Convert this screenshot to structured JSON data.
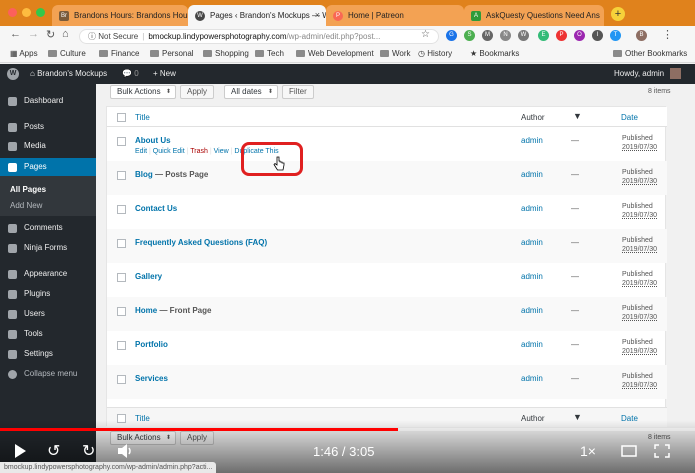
{
  "browser": {
    "tabs": [
      {
        "label": "Brandons Hours: Brandons Hours",
        "favicon": "Br"
      },
      {
        "label": "Pages ‹ Brandon's Mockups — Wo",
        "favicon": "W"
      },
      {
        "label": "Home | Patreon",
        "favicon": "P"
      },
      {
        "label": "AskQuesty Questions Need Ans",
        "favicon": "A"
      }
    ],
    "address": {
      "security": "Not Secure",
      "host": "bmockup.lindypowersphotography.com",
      "path": "/wp-admin/edit.php?post..."
    },
    "bookmarks": [
      "Apps",
      "Culture",
      "Finance",
      "Personal",
      "Shopping",
      "Tech",
      "Web Development",
      "Work",
      "History",
      "Bookmarks",
      "Other Bookmarks"
    ]
  },
  "admin_bar": {
    "site_name": "Brandon's Mockups",
    "comments_count": "0",
    "new_label": "+ New",
    "greeting": "Howdy, admin"
  },
  "sidebar": {
    "items": [
      {
        "label": "Dashboard"
      },
      {
        "label": "Posts"
      },
      {
        "label": "Media"
      },
      {
        "label": "Pages"
      },
      {
        "label": "Comments"
      },
      {
        "label": "Ninja Forms"
      },
      {
        "label": "Appearance"
      },
      {
        "label": "Plugins"
      },
      {
        "label": "Users"
      },
      {
        "label": "Tools"
      },
      {
        "label": "Settings"
      },
      {
        "label": "Collapse menu"
      }
    ],
    "submenu": [
      {
        "label": "All Pages"
      },
      {
        "label": "Add New"
      }
    ]
  },
  "list": {
    "bulk_actions": "Bulk Actions",
    "apply": "Apply",
    "all_dates": "All dates",
    "filter": "Filter",
    "items_count": "8 items",
    "columns": {
      "title": "Title",
      "author": "Author",
      "date": "Date"
    },
    "row_actions": {
      "edit": "Edit",
      "quick_edit": "Quick Edit",
      "trash": "Trash",
      "view": "View",
      "duplicate": "Duplicate This"
    },
    "rows": [
      {
        "title": "About Us",
        "state": "",
        "author": "admin",
        "comments": "—",
        "status": "Published",
        "date": "2019/07/30"
      },
      {
        "title": "Blog",
        "state": " — Posts Page",
        "author": "admin",
        "comments": "—",
        "status": "Published",
        "date": "2019/07/30"
      },
      {
        "title": "Contact Us",
        "state": "",
        "author": "admin",
        "comments": "—",
        "status": "Published",
        "date": "2019/07/30"
      },
      {
        "title": "Frequently Asked Questions (FAQ)",
        "state": "",
        "author": "admin",
        "comments": "—",
        "status": "Published",
        "date": "2019/07/30"
      },
      {
        "title": "Gallery",
        "state": "",
        "author": "admin",
        "comments": "—",
        "status": "Published",
        "date": "2019/07/30"
      },
      {
        "title": "Home",
        "state": " — Front Page",
        "author": "admin",
        "comments": "—",
        "status": "Published",
        "date": "2019/07/30"
      },
      {
        "title": "Portfolio",
        "state": "",
        "author": "admin",
        "comments": "—",
        "status": "Published",
        "date": "2019/07/30"
      },
      {
        "title": "Services",
        "state": "",
        "author": "admin",
        "comments": "—",
        "status": "Published",
        "date": "2019/07/30"
      }
    ]
  },
  "video": {
    "time": "1:46 / 3:05",
    "speed": "1×",
    "progress": 0.573
  },
  "status_url": "bmockup.lindypowersphotography.com/wp-admin/admin.php?acti...",
  "colors": {
    "chrome_orange": "#e0821c",
    "wp_dark": "#23282d",
    "wp_blue": "#0073aa",
    "highlight_red": "#e02020",
    "progress_red": "#ff0000"
  }
}
